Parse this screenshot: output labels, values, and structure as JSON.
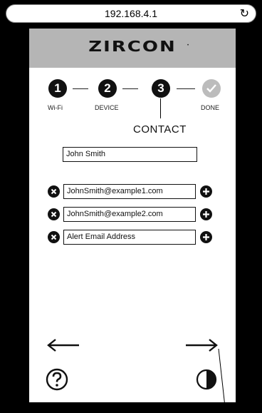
{
  "browser": {
    "url": "192.168.4.1",
    "reload_icon": "reload-icon"
  },
  "app": {
    "brand": "ZIRCON",
    "brand_mark": "•"
  },
  "stepper": {
    "steps": [
      {
        "number": "1",
        "label": "Wi-Fi",
        "state": "complete"
      },
      {
        "number": "2",
        "label": "DEVICE",
        "state": "complete"
      },
      {
        "number": "3",
        "label": "",
        "state": "current"
      },
      {
        "number": "",
        "label": "DONE",
        "state": "pending",
        "icon": "checkmark-icon"
      }
    ]
  },
  "section": {
    "title": "CONTACT"
  },
  "form": {
    "name": {
      "value": "John Smith"
    },
    "emails": [
      {
        "value": "JohnSmith@example1.com"
      },
      {
        "value": "JohnSmith@example2.com"
      },
      {
        "value": "",
        "placeholder": "Alert Email Address"
      }
    ]
  },
  "icons": {
    "remove": "close-circle-icon",
    "add": "plus-circle-icon",
    "back": "arrow-left-icon",
    "next": "arrow-right-icon",
    "help": "question-circle-icon",
    "contrast": "contrast-icon"
  },
  "colors": {
    "header": "#b5b5b5",
    "step_active": "#111111",
    "step_pending": "#bcbcbc"
  }
}
